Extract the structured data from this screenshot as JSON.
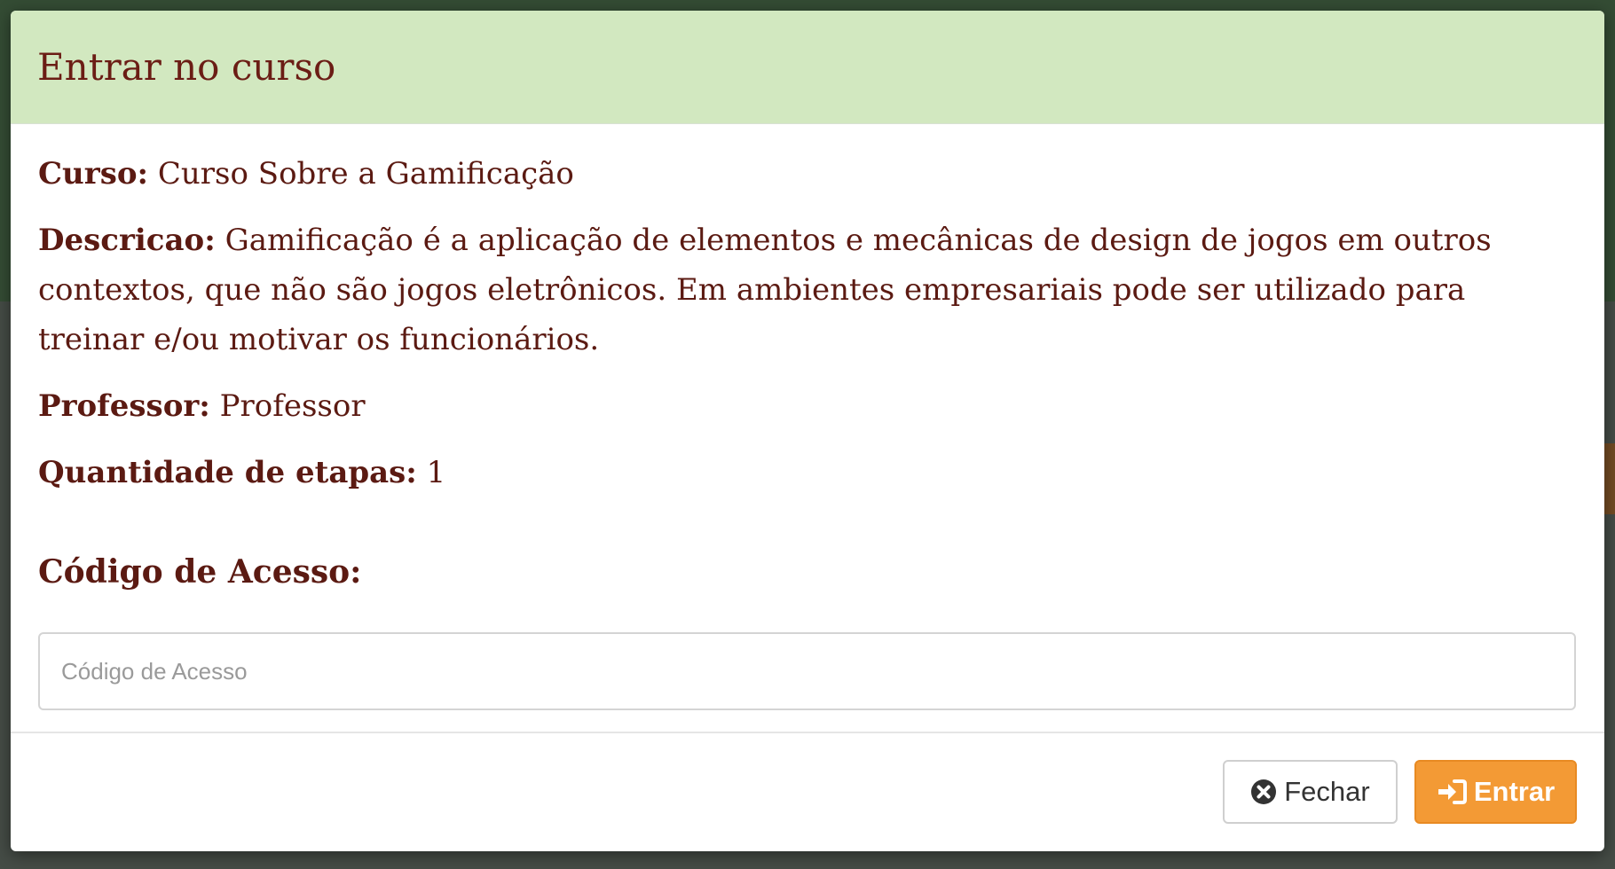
{
  "modal": {
    "title": "Entrar no curso",
    "course_label": "Curso:",
    "course_value": "Curso Sobre a Gamificação",
    "description_label": "Descricao:",
    "description_value": "Gamificação é a aplicação de elementos e mecânicas de design de jogos em outros contextos, que não são jogos eletrônicos. Em ambientes empresariais pode ser utilizado para treinar e/ou motivar os funcionários.",
    "teacher_label": "Professor:",
    "teacher_value": "Professor",
    "steps_label": "Quantidade de etapas:",
    "steps_value": "1",
    "access_code_label": "Código de Acesso:",
    "access_code_placeholder": "Código de Acesso",
    "access_code_value": ""
  },
  "footer": {
    "close_label": "Fechar",
    "enter_label": "Entrar",
    "close_icon": "times-circle-icon",
    "enter_icon": "sign-in-icon"
  },
  "colors": {
    "header_bg": "#d2e8c0",
    "text_brown": "#5b1a12",
    "enter_orange": "#f39a35"
  }
}
